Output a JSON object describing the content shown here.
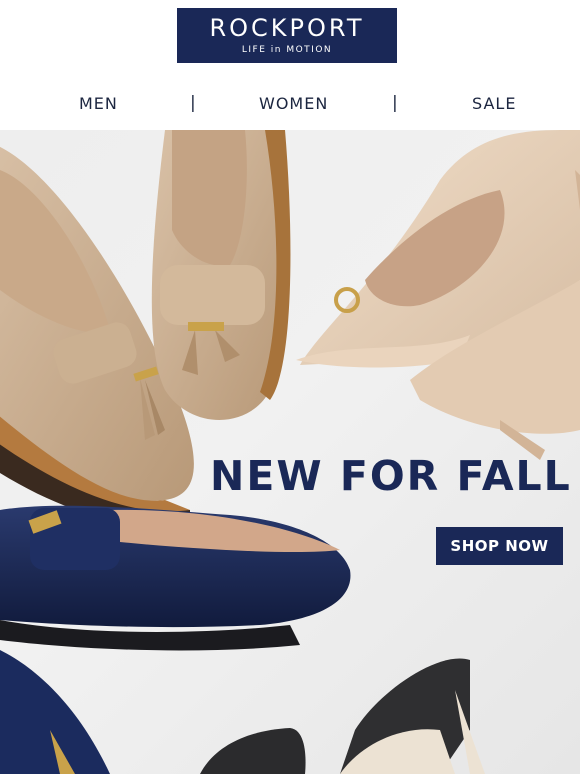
{
  "brand": {
    "name": "ROCKPORT",
    "tagline": "LIFE in MOTION",
    "color": "#1a2857"
  },
  "nav": {
    "items": [
      {
        "label": "MEN"
      },
      {
        "label": "WOMEN"
      },
      {
        "label": "SALE"
      }
    ],
    "separator": "|"
  },
  "hero": {
    "headline": "NEW FOR FALL",
    "cta_label": "SHOP NOW",
    "image_description_icon": "shoes-photo"
  }
}
